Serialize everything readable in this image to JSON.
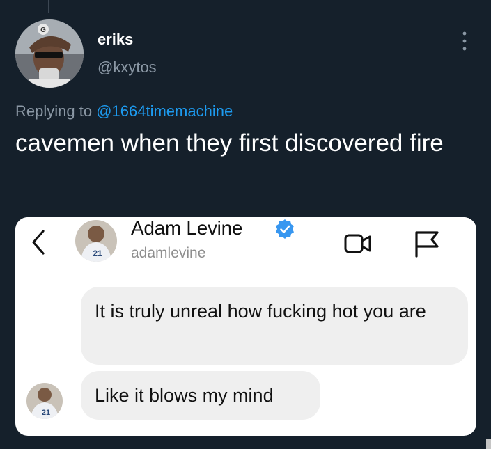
{
  "tweet": {
    "display_name": "eriks",
    "handle": "@kxytos",
    "replying_prefix": "Replying to",
    "replying_to": "@1664timemachine",
    "text": "cavemen when they first discovered fire",
    "avatar_icon": "profile-photo",
    "more_icon": "more-options-icon"
  },
  "media": {
    "back_icon": "chevron-left-icon",
    "contact_name": "Adam Levine",
    "contact_username": "adamlevine",
    "verified_icon": "verified-badge-icon",
    "video_icon": "video-call-icon",
    "flag_icon": "flag-icon",
    "messages": [
      {
        "text": "It is truly unreal how fucking hot you are"
      },
      {
        "text": "Like it blows my mind"
      }
    ]
  },
  "colors": {
    "background": "#15202b",
    "link": "#1d9bf0",
    "muted": "#8b98a5",
    "verified": "#3897f0",
    "bubble": "#efefef"
  }
}
